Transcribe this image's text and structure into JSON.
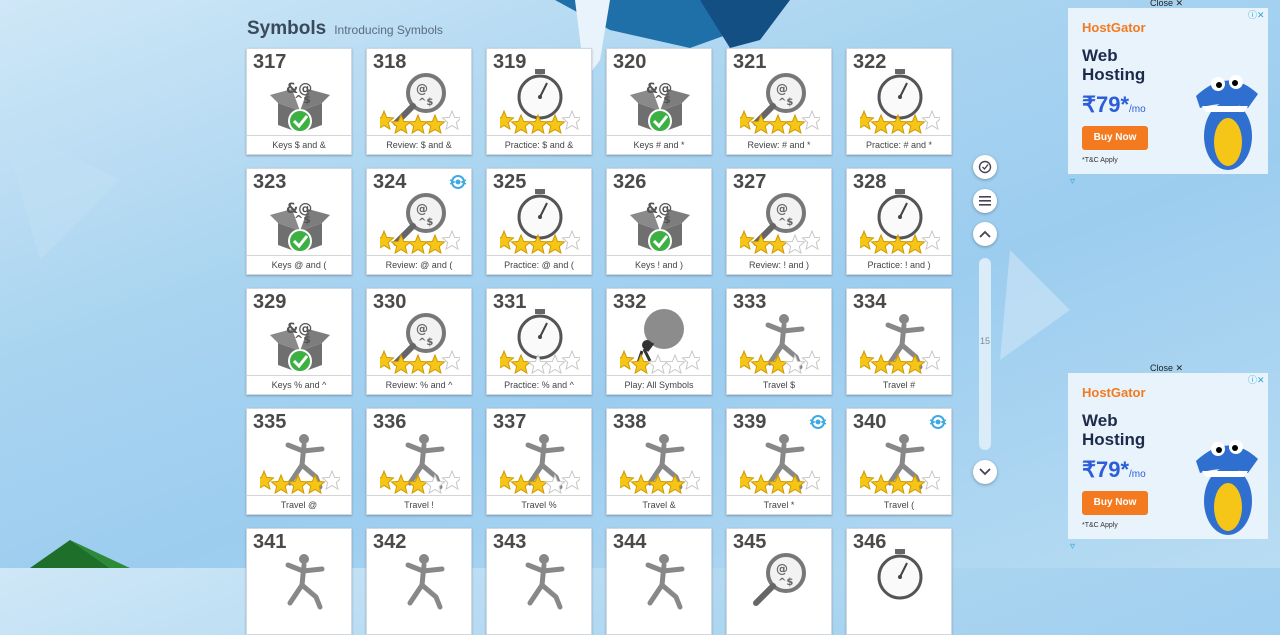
{
  "header": {
    "title": "Symbols",
    "subtitle": "Introducing Symbols"
  },
  "tiles": [
    {
      "num": "317",
      "label": "Keys $ and &",
      "icon": "box-icon",
      "stars": 0,
      "check": true,
      "badge": false
    },
    {
      "num": "318",
      "label": "Review: $ and &",
      "icon": "magnifier-icon",
      "stars": 4,
      "check": false,
      "badge": false
    },
    {
      "num": "319",
      "label": "Practice: $ and &",
      "icon": "stopwatch-icon",
      "stars": 4,
      "check": false,
      "badge": false
    },
    {
      "num": "320",
      "label": "Keys # and *",
      "icon": "box-icon",
      "stars": 0,
      "check": true,
      "badge": false
    },
    {
      "num": "321",
      "label": "Review: # and *",
      "icon": "magnifier-icon",
      "stars": 4,
      "check": false,
      "badge": false
    },
    {
      "num": "322",
      "label": "Practice: # and *",
      "icon": "stopwatch-icon",
      "stars": 4,
      "check": false,
      "badge": false
    },
    {
      "num": "323",
      "label": "Keys @ and (",
      "icon": "box-icon",
      "stars": 0,
      "check": true,
      "badge": false
    },
    {
      "num": "324",
      "label": "Review: @ and (",
      "icon": "magnifier-icon",
      "stars": 4,
      "check": false,
      "badge": true
    },
    {
      "num": "325",
      "label": "Practice: @ and (",
      "icon": "stopwatch-icon",
      "stars": 4,
      "check": false,
      "badge": false
    },
    {
      "num": "326",
      "label": "Keys ! and )",
      "icon": "box-icon",
      "stars": 0,
      "check": true,
      "badge": false
    },
    {
      "num": "327",
      "label": "Review: ! and )",
      "icon": "magnifier-icon",
      "stars": 3,
      "check": false,
      "badge": false
    },
    {
      "num": "328",
      "label": "Practice: ! and )",
      "icon": "stopwatch-icon",
      "stars": 4,
      "check": false,
      "badge": false
    },
    {
      "num": "329",
      "label": "Keys % and ^",
      "icon": "box-icon",
      "stars": 0,
      "check": true,
      "badge": false
    },
    {
      "num": "330",
      "label": "Review: % and ^",
      "icon": "magnifier-icon",
      "stars": 4,
      "check": false,
      "badge": false
    },
    {
      "num": "331",
      "label": "Practice: % and ^",
      "icon": "stopwatch-icon",
      "stars": 2,
      "check": false,
      "badge": false
    },
    {
      "num": "332",
      "label": "Play: All Symbols",
      "icon": "boulder-icon",
      "stars": 2,
      "check": false,
      "badge": false
    },
    {
      "num": "333",
      "label": "Travel $",
      "icon": "runner-icon",
      "stars": 3,
      "check": false,
      "badge": false
    },
    {
      "num": "334",
      "label": "Travel #",
      "icon": "runner-icon",
      "stars": 4,
      "check": false,
      "badge": false
    },
    {
      "num": "335",
      "label": "Travel @",
      "icon": "runner-icon",
      "stars": 4,
      "check": false,
      "badge": false
    },
    {
      "num": "336",
      "label": "Travel !",
      "icon": "runner-icon",
      "stars": 3,
      "check": false,
      "badge": false
    },
    {
      "num": "337",
      "label": "Travel %",
      "icon": "runner-icon",
      "stars": 3,
      "check": false,
      "badge": false
    },
    {
      "num": "338",
      "label": "Travel &",
      "icon": "runner-icon",
      "stars": 4,
      "check": false,
      "badge": false
    },
    {
      "num": "339",
      "label": "Travel *",
      "icon": "runner-icon",
      "stars": 4,
      "check": false,
      "badge": true
    },
    {
      "num": "340",
      "label": "Travel (",
      "icon": "runner-icon",
      "stars": 4,
      "check": false,
      "badge": true
    },
    {
      "num": "341",
      "label": "",
      "icon": "runner-icon",
      "stars": 0,
      "check": false,
      "badge": false
    },
    {
      "num": "342",
      "label": "",
      "icon": "runner-icon",
      "stars": 0,
      "check": false,
      "badge": false
    },
    {
      "num": "343",
      "label": "",
      "icon": "runner-icon",
      "stars": 0,
      "check": false,
      "badge": false
    },
    {
      "num": "344",
      "label": "",
      "icon": "runner-icon",
      "stars": 0,
      "check": false,
      "badge": false
    },
    {
      "num": "345",
      "label": "",
      "icon": "magnifier-icon",
      "stars": 0,
      "check": false,
      "badge": false
    },
    {
      "num": "346",
      "label": "",
      "icon": "stopwatch-icon",
      "stars": 0,
      "check": false,
      "badge": false
    }
  ],
  "sidebar": {
    "page_indicator": "15"
  },
  "ads": [
    {
      "close_label": "Close",
      "brand": "HostGator",
      "headline": "Web Hosting",
      "price": "₹79*",
      "per": "/mo",
      "button": "Buy Now",
      "terms": "*T&C Apply"
    },
    {
      "close_label": "Close",
      "brand": "HostGator",
      "headline": "Web Hosting",
      "price": "₹79*",
      "per": "/mo",
      "button": "Buy Now",
      "terms": "*T&C Apply"
    }
  ],
  "colors": {
    "star": "#f5c518",
    "check": "#3cb043",
    "accent_ad": "#f47a20"
  }
}
